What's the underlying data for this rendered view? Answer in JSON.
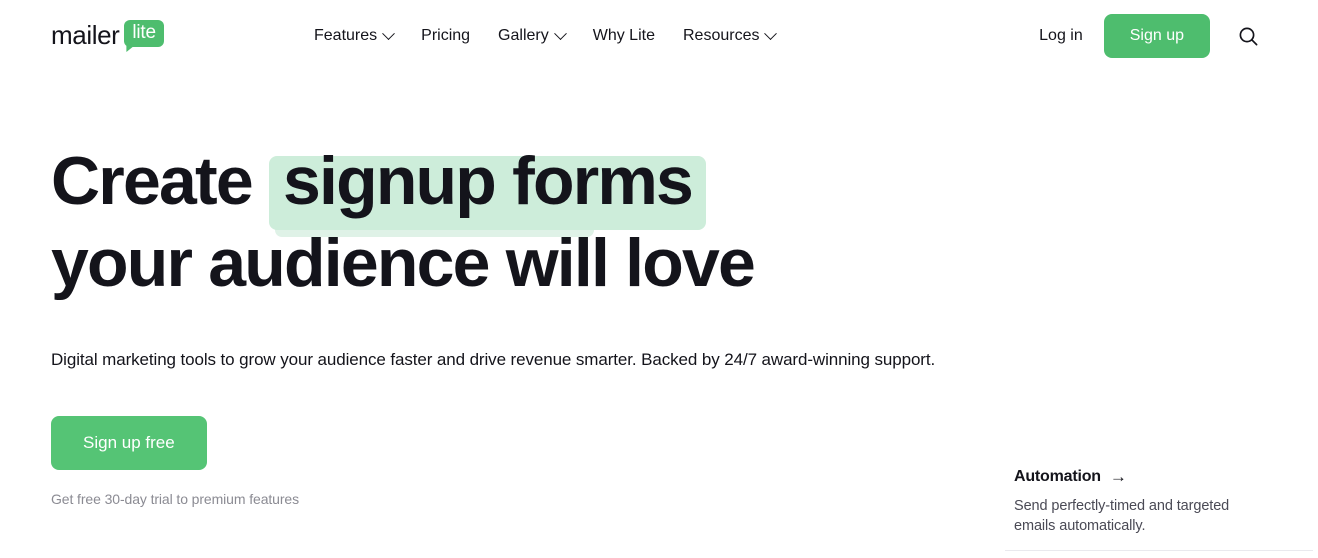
{
  "header": {
    "logo": {
      "word": "mailer",
      "badge": "lite",
      "badge_color": "#4ebd6e",
      "name": "mailerlite-logo"
    },
    "nav": [
      {
        "label": "Features",
        "has_dropdown": true,
        "icon": "chevron-down-icon"
      },
      {
        "label": "Pricing",
        "has_dropdown": false,
        "icon": ""
      },
      {
        "label": "Gallery",
        "has_dropdown": true,
        "icon": "chevron-down-icon"
      },
      {
        "label": "Why Lite",
        "has_dropdown": false,
        "icon": ""
      },
      {
        "label": "Resources",
        "has_dropdown": true,
        "icon": "chevron-down-icon"
      }
    ],
    "login_label": "Log in",
    "signup_label": "Sign up",
    "search_icon": "search-icon"
  },
  "hero": {
    "headline_line1_plain": "Create",
    "headline_line1_highlight": "signup forms",
    "headline_line2": "your audience will love",
    "highlight_color": "#cdedda",
    "subheading": "Digital marketing tools to grow your audience faster and drive revenue smarter. Backed by 24/7 award-winning support.",
    "cta_label": "Sign up free",
    "cta_color": "#55c475",
    "cta_note": "Get free 30-day trial to premium features"
  },
  "feature_card": {
    "title": "Automation",
    "arrow": "→",
    "description": "Send perfectly-timed and targeted emails automatically."
  }
}
